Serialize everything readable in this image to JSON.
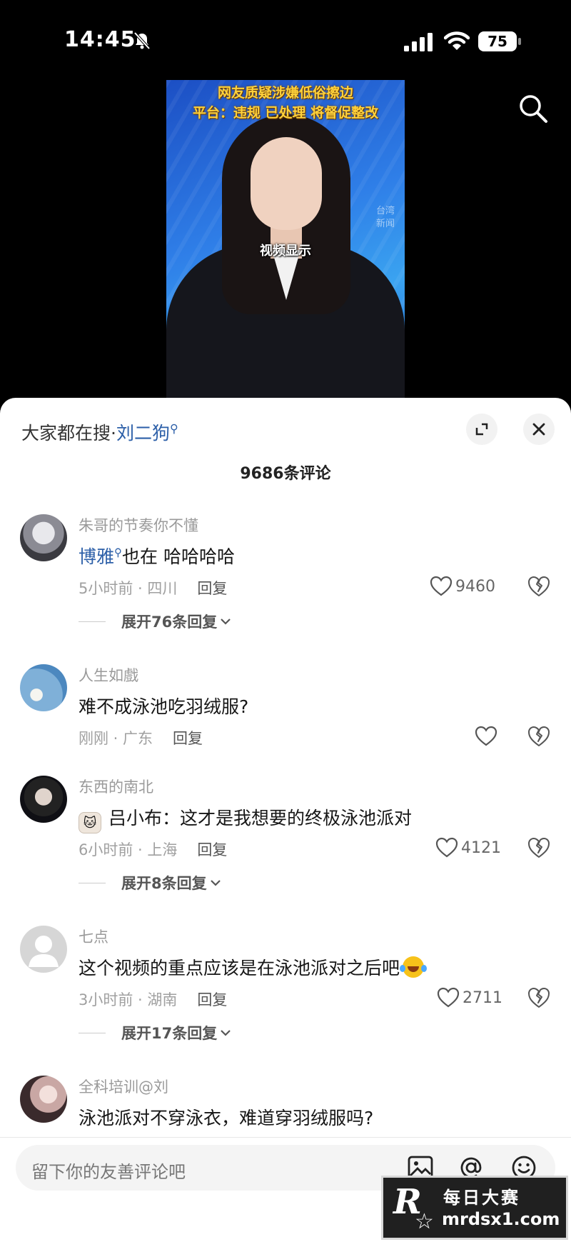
{
  "status": {
    "time": "14:45",
    "battery": "75"
  },
  "video": {
    "headline_line1": "网友质疑涉嫌低俗擦边",
    "headline_line2": "平台：违规 已处理 将督促整改",
    "caption": "视频显示",
    "watermark": "台湾\n新闻"
  },
  "panel": {
    "hot_search_prefix": "大家都在搜·",
    "hot_search_term": "刘二狗",
    "comment_count": "9686条评论"
  },
  "comments": [
    {
      "user": "朱哥的节奏你不懂",
      "mention": "博雅",
      "text": "也在  哈哈哈哈",
      "time_loc": "5小时前 · 四川",
      "reply": "回复",
      "likes": "9460",
      "expand": "展开76条回复"
    },
    {
      "user": "人生如戲",
      "text": "难不成泳池吃羽绒服?",
      "time_loc": "刚刚 · 广东",
      "reply": "回复",
      "likes": ""
    },
    {
      "user": "东西的南北",
      "text": "吕小布：这才是我想要的终极泳池派对",
      "time_loc": "6小时前 · 上海",
      "reply": "回复",
      "likes": "4121",
      "expand": "展开8条回复"
    },
    {
      "user": "七点",
      "text": "这个视频的重点应该是在泳池派对之后吧",
      "time_loc": "3小时前 · 湖南",
      "reply": "回复",
      "likes": "2711",
      "expand": "展开17条回复"
    },
    {
      "user": "全科培训@刘",
      "text": "泳池派对不穿泳衣，难道穿羽绒服吗?"
    }
  ],
  "input": {
    "placeholder": "留下你的友善评论吧"
  },
  "logo": {
    "line1": "每日大赛",
    "line2": "mrdsx1.com",
    "mark": "R"
  },
  "colors": {
    "link": "#2c5fa8",
    "panel_bg": "#ffffff",
    "video_bg": "#2f7fe8"
  }
}
